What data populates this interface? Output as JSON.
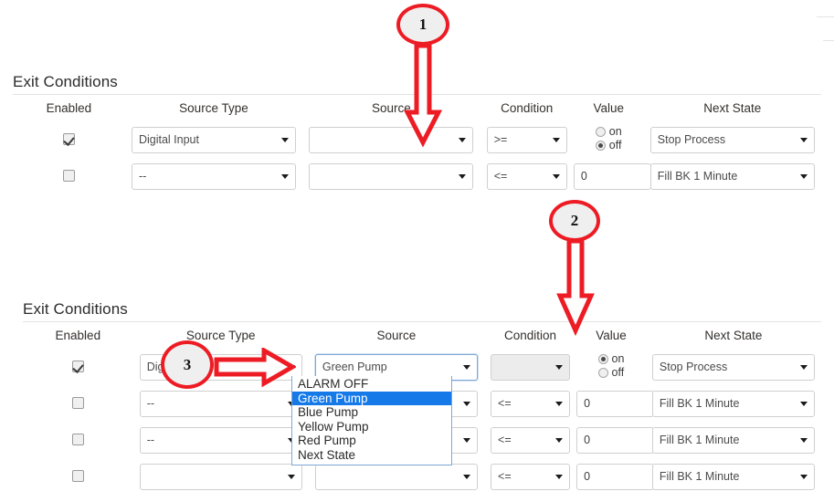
{
  "page": {
    "accent_red": "#ed1c24",
    "highlight_blue": "#1579e8",
    "focus_border": "#7fa7d4"
  },
  "sections": [
    {
      "id": "top",
      "title": "Exit Conditions",
      "headers": [
        "Enabled",
        "Source Type",
        "Source",
        "Condition",
        "Value",
        "Next State"
      ],
      "rows": [
        {
          "enabled": true,
          "source_type": "Digital Input",
          "source": "",
          "condition": ">=",
          "value_kind": "radio",
          "value_on_label": "on",
          "value_off_label": "off",
          "value_selected": "off",
          "next_state": "Stop Process"
        },
        {
          "enabled": false,
          "source_type": "--",
          "source": "",
          "condition": "<=",
          "value_kind": "text",
          "value": "0",
          "next_state": "Fill BK 1 Minute"
        }
      ]
    },
    {
      "id": "bottom",
      "title": "Exit Conditions",
      "headers": [
        "Enabled",
        "Source Type",
        "Source",
        "Condition",
        "Value",
        "Next State"
      ],
      "rows": [
        {
          "enabled": true,
          "source_type": "Digital Input",
          "source": "Green Pump",
          "source_open": true,
          "condition": "",
          "condition_disabled": true,
          "value_kind": "radio",
          "value_on_label": "on",
          "value_off_label": "off",
          "value_selected": "on",
          "next_state": "Stop Process"
        },
        {
          "enabled": false,
          "source_type": "--",
          "source": "",
          "condition": "<=",
          "value_kind": "text",
          "value": "0",
          "next_state": "Fill BK 1 Minute"
        },
        {
          "enabled": false,
          "source_type": "--",
          "source": "",
          "condition": "<=",
          "value_kind": "text",
          "value": "0",
          "next_state": "Fill BK 1 Minute"
        },
        {
          "enabled": false,
          "source_type": "",
          "source": "",
          "condition": "<=",
          "value_kind": "text",
          "value": "0",
          "next_state": "Fill BK 1 Minute"
        }
      ]
    }
  ],
  "source_dropdown": {
    "selected": "Green Pump",
    "options": [
      "ALARM OFF",
      "Green Pump",
      "Blue Pump",
      "Yellow Pump",
      "Red Pump",
      "Next State"
    ]
  },
  "annotations": [
    {
      "id": "m1",
      "label": "1",
      "arrow": "down"
    },
    {
      "id": "m2",
      "label": "2",
      "arrow": "down"
    },
    {
      "id": "m3",
      "label": "3",
      "arrow": "right"
    }
  ]
}
